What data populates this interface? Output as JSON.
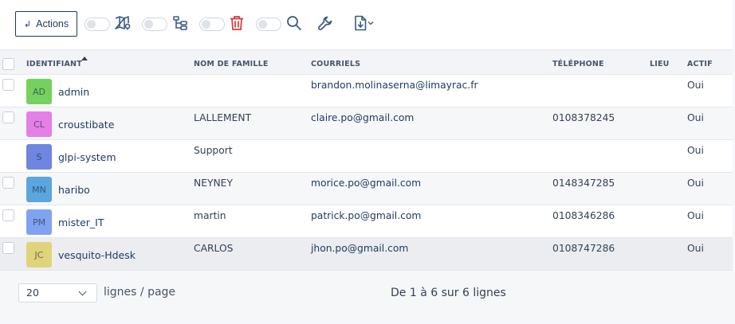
{
  "toolbar": {
    "actions_label": "Actions",
    "icons": [
      "map-icon",
      "tree-icon",
      "trash-icon",
      "search-icon",
      "wrench-icon",
      "export-icon",
      "chevron-down-icon"
    ],
    "trash_color": "#d63939"
  },
  "table": {
    "headers": {
      "login": "IDENTIFIANT",
      "lastname": "NOM DE FAMILLE",
      "email": "COURRIELS",
      "phone": "TÉLÉPHONE",
      "location": "LIEU",
      "active": "ACTIF"
    },
    "rows": [
      {
        "initials": "AD",
        "avatar_color": "#74d160",
        "login": "admin",
        "lastname": "",
        "email": "brandon.molinaserna@limayrac.fr",
        "phone": "",
        "location": "",
        "active": "Oui"
      },
      {
        "initials": "CL",
        "avatar_color": "#e47fe8",
        "login": "croustibate",
        "lastname": "LALLEMENT",
        "email": "claire.po@gmail.com",
        "phone": "0108378245",
        "location": "",
        "active": "Oui"
      },
      {
        "initials": "S",
        "avatar_color": "#6f85e0",
        "login": "glpi-system",
        "lastname": "Support",
        "email": "",
        "phone": "",
        "location": "",
        "active": "Oui"
      },
      {
        "initials": "MN",
        "avatar_color": "#5aa6de",
        "login": "haribo",
        "lastname": "NEYNEY",
        "email": "morice.po@gmail.com",
        "phone": "0148347285",
        "location": "",
        "active": "Oui"
      },
      {
        "initials": "PM",
        "avatar_color": "#7fa3f0",
        "login": "mister_IT",
        "lastname": "martin",
        "email": "patrick.po@gmail.com",
        "phone": "0108346286",
        "location": "",
        "active": "Oui"
      },
      {
        "initials": "JC",
        "avatar_color": "#e0d47a",
        "login": "vesquito-Hdesk",
        "lastname": "CARLOS",
        "email": "jhon.po@gmail.com",
        "phone": "0108747286",
        "location": "",
        "active": "Oui"
      }
    ]
  },
  "footer": {
    "per_page_value": "20",
    "per_page_label": "lignes / page",
    "count_text": "De 1 à 6 sur 6 lignes"
  }
}
